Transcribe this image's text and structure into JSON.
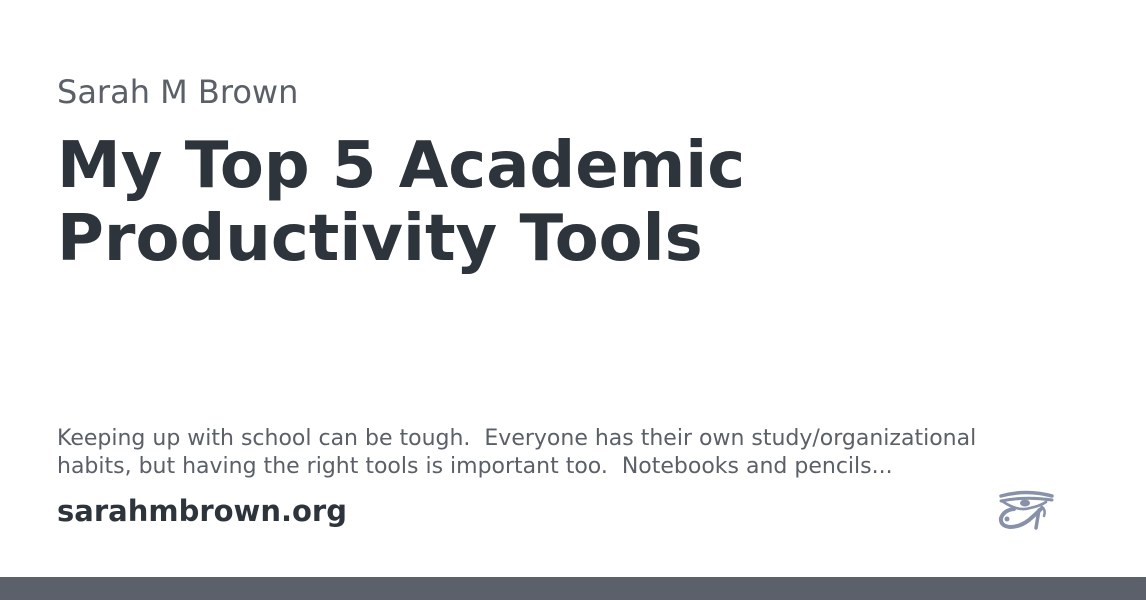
{
  "card": {
    "author": "Sarah M Brown",
    "title_lines": [
      "My Top 5 Academic",
      "Productivity Tools"
    ],
    "excerpt_lines": [
      "Keeping up with school can be tough.  Everyone has their own study/organizational",
      "habits, but having the right tools is important too.  Notebooks and pencils..."
    ],
    "site": "sarahmbrown.org",
    "logo_icon": "eye-of-horus-icon"
  },
  "colors": {
    "heading": "#2e343b",
    "muted": "#5b6068",
    "logo": "#8792a9",
    "bar": "#5b606b"
  }
}
